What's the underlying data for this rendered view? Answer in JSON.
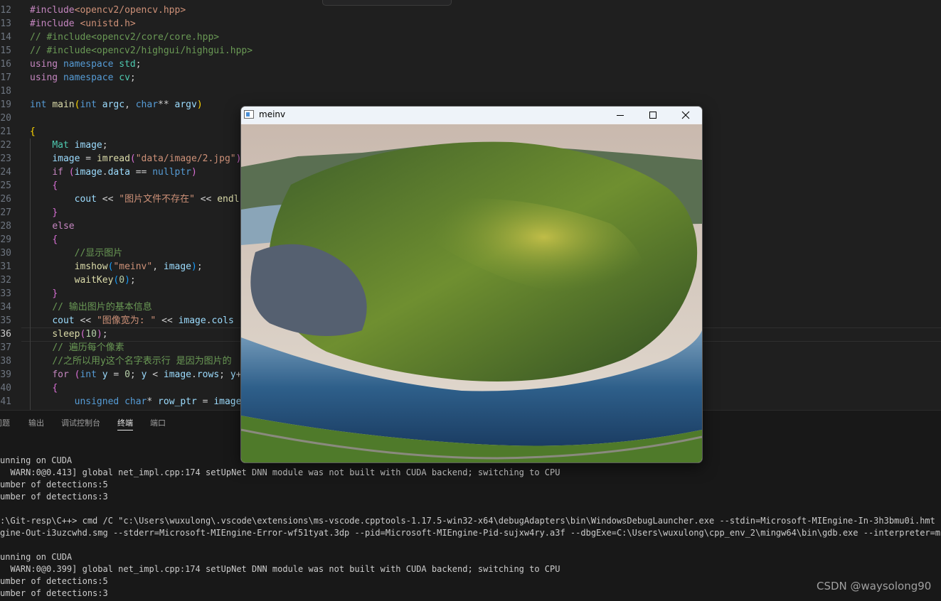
{
  "editor": {
    "active_line": 36,
    "lines": [
      {
        "num": "12",
        "tokens": [
          [
            "k1",
            "#include"
          ],
          [
            "st",
            "<opencv2/opencv.hpp>"
          ]
        ]
      },
      {
        "num": "13",
        "tokens": [
          [
            "k1",
            "#include "
          ],
          [
            "st",
            "<unistd.h>"
          ]
        ]
      },
      {
        "num": "14",
        "tokens": [
          [
            "cm",
            "// #include<opencv2/core/core.hpp>"
          ]
        ]
      },
      {
        "num": "15",
        "tokens": [
          [
            "cm",
            "// #include<opencv2/highgui/highgui.hpp>"
          ]
        ]
      },
      {
        "num": "16",
        "tokens": [
          [
            "k1",
            "using "
          ],
          [
            "k2",
            "namespace "
          ],
          [
            "ty",
            "std"
          ],
          [
            "",
            "; "
          ]
        ]
      },
      {
        "num": "17",
        "tokens": [
          [
            "k1",
            "using "
          ],
          [
            "k2",
            "namespace "
          ],
          [
            "ty",
            "cv"
          ],
          [
            "",
            ";"
          ]
        ]
      },
      {
        "num": "18",
        "tokens": []
      },
      {
        "num": "19",
        "tokens": [
          [
            "k2",
            "int "
          ],
          [
            "fn",
            "main"
          ],
          [
            "br1",
            "("
          ],
          [
            "k2",
            "int "
          ],
          [
            "vr",
            "argc"
          ],
          [
            "",
            ", "
          ],
          [
            "k2",
            "char"
          ],
          [
            "",
            "** "
          ],
          [
            "vr",
            "argv"
          ],
          [
            "br1",
            ")"
          ]
        ]
      },
      {
        "num": "20",
        "tokens": []
      },
      {
        "num": "21",
        "tokens": [
          [
            "br1",
            "{"
          ]
        ]
      },
      {
        "num": "22",
        "tokens": [
          [
            "",
            "    "
          ],
          [
            "ty",
            "Mat "
          ],
          [
            "vr",
            "image"
          ],
          [
            "",
            ";"
          ]
        ]
      },
      {
        "num": "23",
        "tokens": [
          [
            "",
            "    "
          ],
          [
            "vr",
            "image"
          ],
          [
            "",
            " = "
          ],
          [
            "fn",
            "imread"
          ],
          [
            "br2",
            "("
          ],
          [
            "st",
            "\"data/image/2.jpg\""
          ],
          [
            "br2",
            ")"
          ],
          [
            "",
            ";"
          ]
        ]
      },
      {
        "num": "24",
        "tokens": [
          [
            "",
            "    "
          ],
          [
            "k1",
            "if "
          ],
          [
            "br2",
            "("
          ],
          [
            "vr",
            "image"
          ],
          [
            "",
            "."
          ],
          [
            "vr",
            "data"
          ],
          [
            "",
            " == "
          ],
          [
            "k2",
            "nullptr"
          ],
          [
            "br2",
            ")"
          ]
        ]
      },
      {
        "num": "25",
        "tokens": [
          [
            "",
            "    "
          ],
          [
            "br2",
            "{"
          ]
        ]
      },
      {
        "num": "26",
        "tokens": [
          [
            "",
            "        "
          ],
          [
            "vr",
            "cout"
          ],
          [
            "",
            " << "
          ],
          [
            "st",
            "\"图片文件不存在\""
          ],
          [
            "",
            " << "
          ],
          [
            "fn",
            "endl"
          ],
          [
            "",
            ";"
          ]
        ]
      },
      {
        "num": "27",
        "tokens": [
          [
            "",
            "    "
          ],
          [
            "br2",
            "}"
          ]
        ]
      },
      {
        "num": "28",
        "tokens": [
          [
            "",
            "    "
          ],
          [
            "k1",
            "else"
          ]
        ]
      },
      {
        "num": "29",
        "tokens": [
          [
            "",
            "    "
          ],
          [
            "br2",
            "{"
          ]
        ]
      },
      {
        "num": "30",
        "tokens": [
          [
            "",
            "        "
          ],
          [
            "cm",
            "//显示图片"
          ]
        ]
      },
      {
        "num": "31",
        "tokens": [
          [
            "",
            "        "
          ],
          [
            "fn",
            "imshow"
          ],
          [
            "br3",
            "("
          ],
          [
            "st",
            "\"meinv\""
          ],
          [
            "",
            ", "
          ],
          [
            "vr",
            "image"
          ],
          [
            "br3",
            ")"
          ],
          [
            "",
            ";"
          ]
        ]
      },
      {
        "num": "32",
        "tokens": [
          [
            "",
            "        "
          ],
          [
            "fn",
            "waitKey"
          ],
          [
            "br3",
            "("
          ],
          [
            "nu",
            "0"
          ],
          [
            "br3",
            ")"
          ],
          [
            "",
            ";"
          ]
        ]
      },
      {
        "num": "33",
        "tokens": [
          [
            "",
            "    "
          ],
          [
            "br2",
            "}"
          ]
        ]
      },
      {
        "num": "34",
        "tokens": [
          [
            "",
            "    "
          ],
          [
            "cm",
            "// 输出图片的基本信息"
          ]
        ]
      },
      {
        "num": "35",
        "tokens": [
          [
            "",
            "    "
          ],
          [
            "vr",
            "cout"
          ],
          [
            "",
            " << "
          ],
          [
            "st",
            "\"图像宽为: \""
          ],
          [
            "",
            " << "
          ],
          [
            "vr",
            "image"
          ],
          [
            "",
            "."
          ],
          [
            "vr",
            "cols"
          ]
        ]
      },
      {
        "num": "36",
        "tokens": [
          [
            "",
            "    "
          ],
          [
            "fn",
            "sleep"
          ],
          [
            "br2",
            "("
          ],
          [
            "nu",
            "10"
          ],
          [
            "br2",
            ")"
          ],
          [
            "",
            ";"
          ]
        ]
      },
      {
        "num": "37",
        "tokens": [
          [
            "",
            "    "
          ],
          [
            "cm",
            "// 遍历每个像素"
          ]
        ]
      },
      {
        "num": "38",
        "tokens": [
          [
            "",
            "    "
          ],
          [
            "cm",
            "//之所以用y这个名字表示行 是因为图片的"
          ]
        ]
      },
      {
        "num": "39",
        "tokens": [
          [
            "",
            "    "
          ],
          [
            "k1",
            "for "
          ],
          [
            "br2",
            "("
          ],
          [
            "k2",
            "int "
          ],
          [
            "vr",
            "y"
          ],
          [
            "",
            " = "
          ],
          [
            "nu",
            "0"
          ],
          [
            "",
            "; "
          ],
          [
            "vr",
            "y"
          ],
          [
            "",
            " < "
          ],
          [
            "vr",
            "image"
          ],
          [
            "",
            "."
          ],
          [
            "vr",
            "rows"
          ],
          [
            "",
            "; "
          ],
          [
            "vr",
            "y"
          ],
          [
            "",
            "+"
          ]
        ]
      },
      {
        "num": "40",
        "tokens": [
          [
            "",
            "    "
          ],
          [
            "br2",
            "{"
          ]
        ]
      },
      {
        "num": "41",
        "tokens": [
          [
            "",
            "        "
          ],
          [
            "k2",
            "unsigned "
          ],
          [
            "k2",
            "char"
          ],
          [
            "",
            "* "
          ],
          [
            "vr",
            "row_ptr"
          ],
          [
            "",
            " = "
          ],
          [
            "vr",
            "image"
          ],
          [
            "",
            "."
          ]
        ]
      }
    ]
  },
  "panel": {
    "tabs": [
      {
        "label": "问题",
        "active": false
      },
      {
        "label": "输出",
        "active": false
      },
      {
        "label": "调试控制台",
        "active": false
      },
      {
        "label": "终端",
        "active": true
      },
      {
        "label": "端口",
        "active": false
      }
    ],
    "terminal_lines": [
      "unning on CUDA",
      "  WARN:0@0.413] global net_impl.cpp:174 setUpNet DNN module was not built with CUDA backend; switching to CPU",
      "umber of detections:5",
      "umber of detections:3",
      "",
      ":\\Git-resp\\C++> cmd /C \"c:\\Users\\wuxulong\\.vscode\\extensions\\ms-vscode.cpptools-1.17.5-win32-x64\\debugAdapters\\bin\\WindowsDebugLauncher.exe --stdin=Microsoft-MIEngine-In-3h3bmu0i.hmt --stdo",
      "gine-Out-i3uzcwhd.smg --stderr=Microsoft-MIEngine-Error-wf51tyat.3dp --pid=Microsoft-MIEngine-Pid-sujxw4ry.a3f --dbgExe=C:\\Users\\wuxulong\\cpp_env_2\\mingw64\\bin\\gdb.exe --interpreter=mi \"",
      "",
      "unning on CUDA",
      "  WARN:0@0.399] global net_impl.cpp:174 setUpNet DNN module was not built with CUDA backend; switching to CPU",
      "umber of detections:5",
      "umber of detections:3"
    ]
  },
  "window": {
    "title": "meinv",
    "icons": [
      "app-icon",
      "minimize-icon",
      "maximize-icon",
      "close-icon"
    ]
  },
  "watermark": "CSDN @waysolong90"
}
